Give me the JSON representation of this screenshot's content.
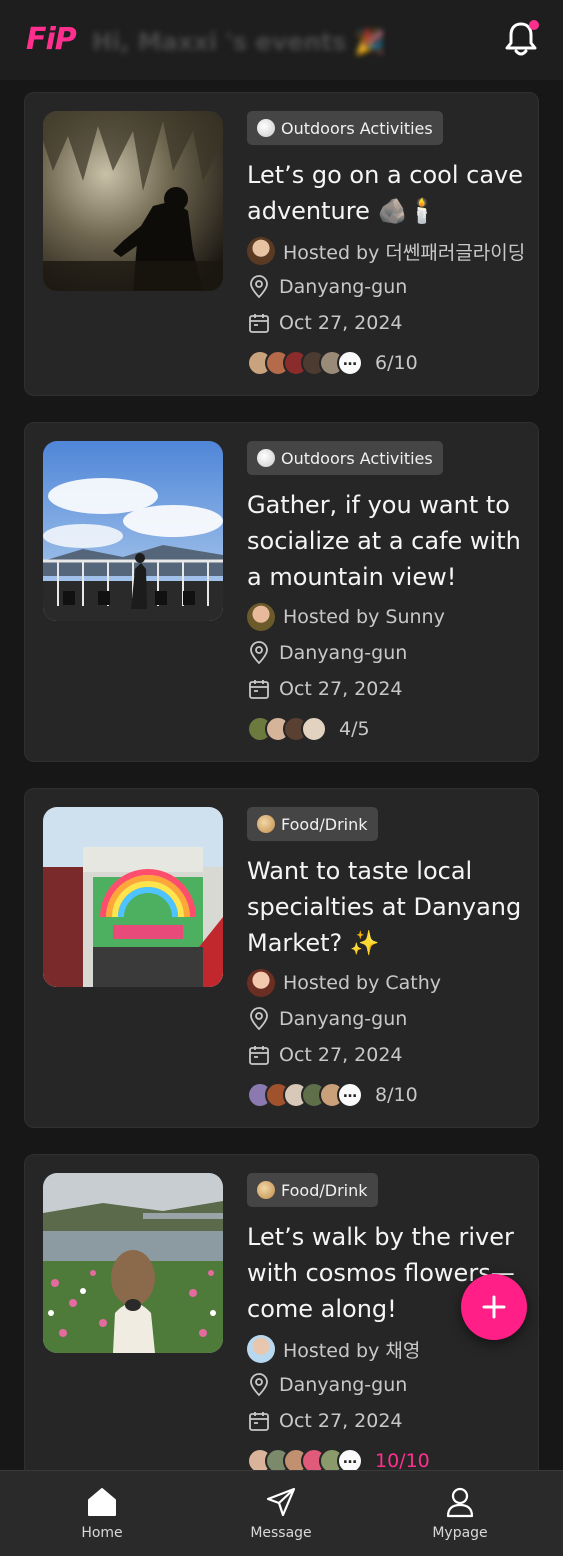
{
  "header": {
    "logo_text": "FiP",
    "title": "Hi, Maxxi 's events 🎉",
    "notification_icon": "bell-icon",
    "has_unread": true
  },
  "events": [
    {
      "category": "Outdoors Activities",
      "category_icon": "baseball-icon",
      "title": "Let’s go on a cool cave adventure 🪨🕯️",
      "host": "Hosted by 더쎈패러글라이딩",
      "location": "Danyang-gun",
      "date": "Oct 27, 2024",
      "count": "6/10",
      "full": false
    },
    {
      "category": "Outdoors Activities",
      "category_icon": "baseball-icon",
      "title": "Gather, if you want to socialize at a cafe with a mountain view!",
      "host": "Hosted by Sunny",
      "location": "Danyang-gun",
      "date": "Oct 27, 2024",
      "count": "4/5",
      "full": false
    },
    {
      "category": "Food/Drink",
      "category_icon": "bread-icon",
      "title": "Want to taste local specialties at Danyang Market? ✨",
      "host": "Hosted by Cathy",
      "location": "Danyang-gun",
      "date": "Oct 27, 2024",
      "count": "8/10",
      "full": false
    },
    {
      "category": "Food/Drink",
      "category_icon": "bread-icon",
      "title": "Let’s walk by the river with cosmos flowers—come along!",
      "host": "Hosted by 채영",
      "location": "Danyang-gun",
      "date": "Oct 27, 2024",
      "count": "10/10",
      "full": true
    }
  ],
  "fab": {
    "icon": "plus-icon"
  },
  "nav": [
    {
      "label": "Home",
      "icon": "home-icon"
    },
    {
      "label": "Message",
      "icon": "paper-plane-icon"
    },
    {
      "label": "Mypage",
      "icon": "user-icon"
    }
  ],
  "colors": {
    "accent": "#ff2f8e",
    "background": "#171717",
    "card": "#262626"
  }
}
